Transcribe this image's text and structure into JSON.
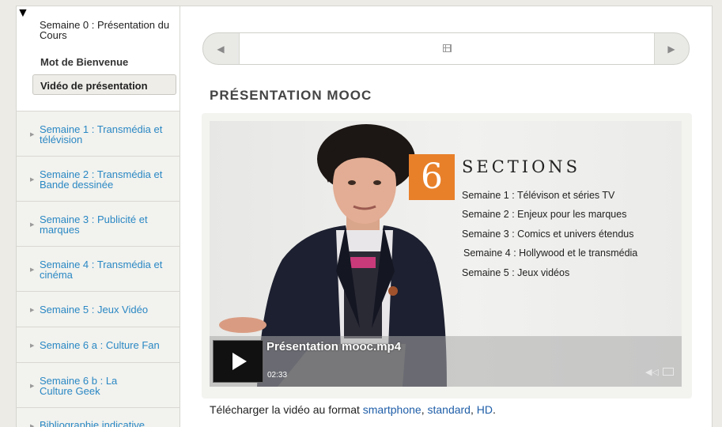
{
  "sidebar": {
    "open_chapter": {
      "title": "Semaine 0 : Présentation du Cours",
      "items": [
        {
          "label": "Mot de Bienvenue"
        },
        {
          "label": "Vidéo de présentation"
        }
      ]
    },
    "chapters": [
      {
        "title": "Semaine 1 : Transmédia et télévision"
      },
      {
        "title": "Semaine 2 : Transmédia et Bande dessinée"
      },
      {
        "title": "Semaine 3 : Publicité et marques"
      },
      {
        "title": "Semaine 4 : Transmédia et cinéma"
      },
      {
        "title": "Semaine 5 : Jeux Vidéo"
      },
      {
        "title": "Semaine 6 a : Culture Fan"
      },
      {
        "title": "Semaine 6 b : La Culture Geek"
      },
      {
        "title": "Bibliographie indicative"
      }
    ]
  },
  "main": {
    "title": "PRÉSENTATION MOOC",
    "video": {
      "title": "Présentation mooc.mp4",
      "time": "02:33",
      "slide": {
        "number": "6",
        "heading": "SECTIONS",
        "weeks": [
          "Semaine 1 : Télévison et séries TV",
          "Semaine 2 : Enjeux pour les marques",
          "Semaine 3 : Comics et univers étendus",
          "Semaine 4 : Hollywood et le transmédia",
          "Semaine 5 : Jeux vidéos"
        ]
      }
    },
    "download": {
      "prefix": "Télécharger la vidéo au format",
      "smartphone": "smartphone",
      "sep1": ",",
      "standard": "standard",
      "sep2": ",",
      "hd": "HD",
      "end": "."
    }
  },
  "colors": {
    "link": "#2a88c4",
    "slide_accent": "#e8802a"
  }
}
